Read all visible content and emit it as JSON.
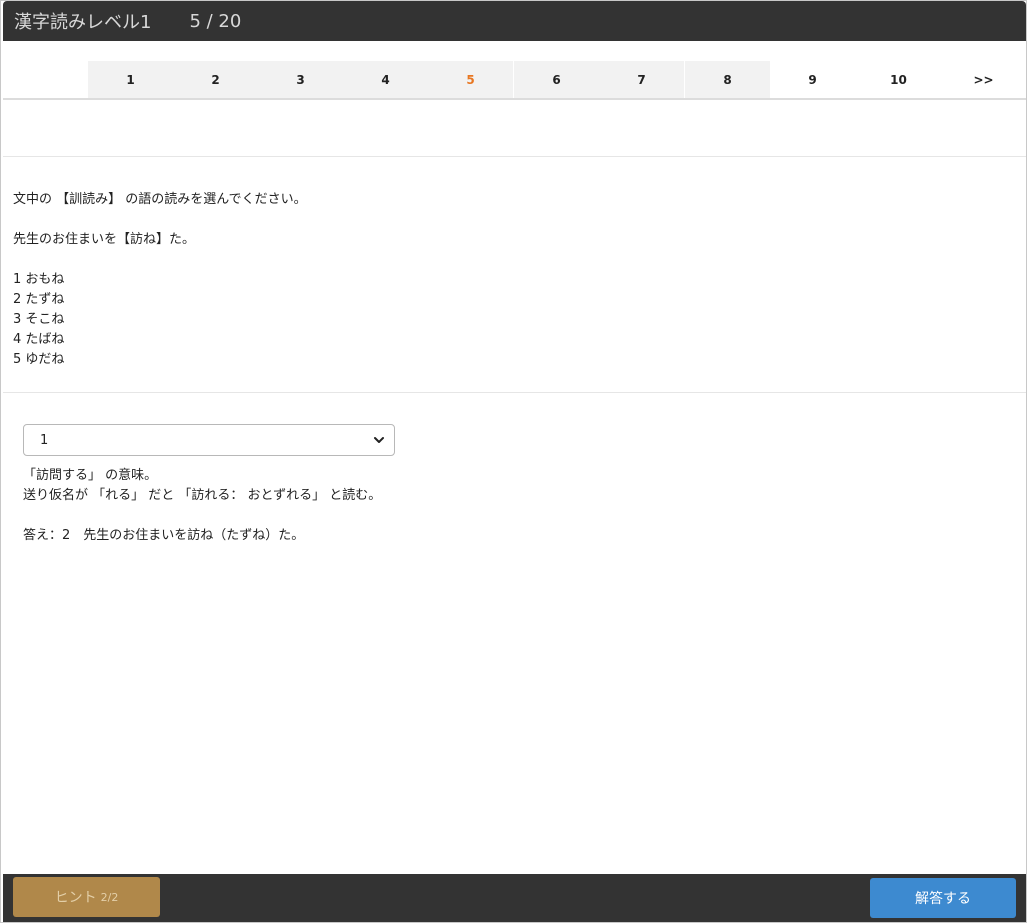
{
  "header": {
    "title": "漢字読みレベル1",
    "progress": "5 / 20"
  },
  "pager": {
    "pages": [
      "1",
      "2",
      "3",
      "4",
      "5",
      "6",
      "7",
      "8",
      "9",
      "10"
    ],
    "next_label": ">>",
    "current": "5"
  },
  "question": {
    "instruction": "文中の 【訓読み】 の語の読みを選んでください。",
    "sentence": "先生のお住まいを【訪ね】た。",
    "choices": [
      "1 おもね",
      "2 たずね",
      "3 そこね",
      "4 たばね",
      "5 ゆだね"
    ]
  },
  "answer_select": {
    "selected": "1"
  },
  "hint": {
    "line1": "「訪問する」 の意味。",
    "line2": "送り仮名が 「れる」 だと 「訪れる： おとずれる」 と読む。",
    "answer": "答え：2　先生のお住まいを訪ね（たずね）た。"
  },
  "footer": {
    "hint_label": "ヒント",
    "hint_count": "2/2",
    "answer_label": "解答する"
  },
  "colors": {
    "header_bg": "#333333",
    "current_page": "#e87722",
    "hint_button": "#b0884a",
    "answer_button": "#3d8ad0"
  },
  "icons": {
    "select_arrow": "chevron-down-icon"
  }
}
